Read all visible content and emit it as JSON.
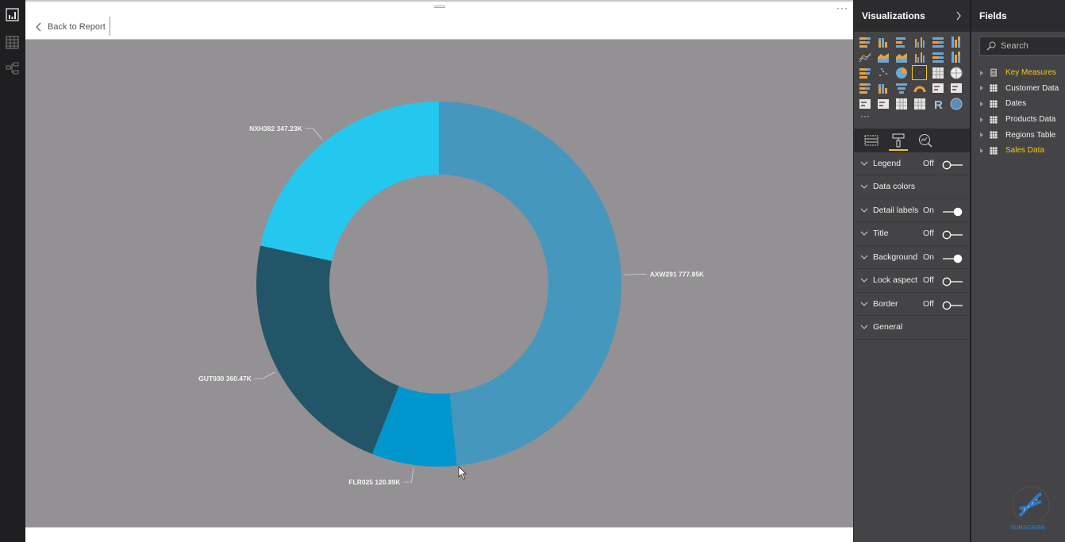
{
  "left_nav": {
    "items": [
      {
        "name": "report-view",
        "icon": "bar-chart-icon",
        "active": true
      },
      {
        "name": "data-view",
        "icon": "table-grid-icon",
        "active": false
      },
      {
        "name": "relationships-view",
        "icon": "relationship-icon",
        "active": false
      }
    ]
  },
  "canvas": {
    "back_label": "Back to Report",
    "more_label": "···"
  },
  "chart_data": {
    "type": "pie",
    "subtype": "donut",
    "title": "",
    "legend": "off",
    "start": "top",
    "direction": "clockwise",
    "unit": "K",
    "slices": [
      {
        "label": "AXW291",
        "value": 777.85,
        "display": "AXW291 777.85K",
        "color": "#4597be"
      },
      {
        "label": "FLR025",
        "value": 120.89,
        "display": "FLR025 120.89K",
        "color": "#0197ce"
      },
      {
        "label": "GUT930",
        "value": 360.47,
        "display": "GUT930 360.47K",
        "color": "#235569"
      },
      {
        "label": "NXH382",
        "value": 347.23,
        "display": "NXH382 347.23K",
        "color": "#24c8ef"
      }
    ],
    "background": "#939193"
  },
  "visualizations": {
    "title": "Visualizations",
    "expand_icon": "chevron-right-icon",
    "icons": [
      "stacked-bar-icon",
      "stacked-column-icon",
      "clustered-bar-icon",
      "clustered-column-icon",
      "100-stacked-bar-icon",
      "100-stacked-column-icon",
      "line-chart-icon",
      "area-chart-icon",
      "stacked-area-icon",
      "line-clustered-column-icon",
      "line-stacked-column-icon",
      "ribbon-chart-icon",
      "waterfall-icon",
      "scatter-icon",
      "pie-chart-icon",
      "donut-chart-icon",
      "treemap-icon",
      "map-icon",
      "filled-map-icon",
      "shape-map-icon",
      "funnel-icon",
      "gauge-icon",
      "card-icon",
      "multi-row-card-icon",
      "kpi-icon",
      "slicer-icon",
      "table-icon",
      "matrix-icon",
      "r-visual-icon",
      "globe-icon"
    ],
    "selected_index": 15,
    "more_label": "···",
    "tabs": [
      {
        "name": "fields-tab",
        "icon": "fields-icon",
        "active": false
      },
      {
        "name": "format-tab",
        "icon": "paint-roller-icon",
        "active": true
      },
      {
        "name": "analytics-tab",
        "icon": "analytics-icon",
        "active": false
      }
    ],
    "format_sections": [
      {
        "label": "Legend",
        "state": "Off",
        "has_toggle": true,
        "on": false
      },
      {
        "label": "Data colors",
        "state": "",
        "has_toggle": false,
        "on": false
      },
      {
        "label": "Detail labels",
        "state": "On",
        "has_toggle": true,
        "on": true
      },
      {
        "label": "Title",
        "state": "Off",
        "has_toggle": true,
        "on": false
      },
      {
        "label": "Background",
        "state": "On",
        "has_toggle": true,
        "on": true
      },
      {
        "label": "Lock aspect",
        "state": "Off",
        "has_toggle": true,
        "on": false
      },
      {
        "label": "Border",
        "state": "Off",
        "has_toggle": true,
        "on": false
      },
      {
        "label": "General",
        "state": "",
        "has_toggle": false,
        "on": false
      }
    ]
  },
  "fields": {
    "title": "Fields",
    "search_placeholder": "Search",
    "tables": [
      {
        "label": "Key Measures",
        "icon": "calculator-icon",
        "highlighted": true
      },
      {
        "label": "Customer Data",
        "icon": "table-icon",
        "highlighted": false
      },
      {
        "label": "Dates",
        "icon": "table-icon",
        "highlighted": false
      },
      {
        "label": "Products Data",
        "icon": "table-icon",
        "highlighted": false
      },
      {
        "label": "Regions Table",
        "icon": "table-icon",
        "highlighted": false
      },
      {
        "label": "Sales Data",
        "icon": "table-icon",
        "highlighted": true
      }
    ]
  },
  "watermark": {
    "label": "SUBSCRIBE",
    "icon": "dna-icon"
  },
  "colors": {
    "accent": "#f2c811",
    "pane_bg": "#444446",
    "header_bg": "#2c2c2e"
  }
}
